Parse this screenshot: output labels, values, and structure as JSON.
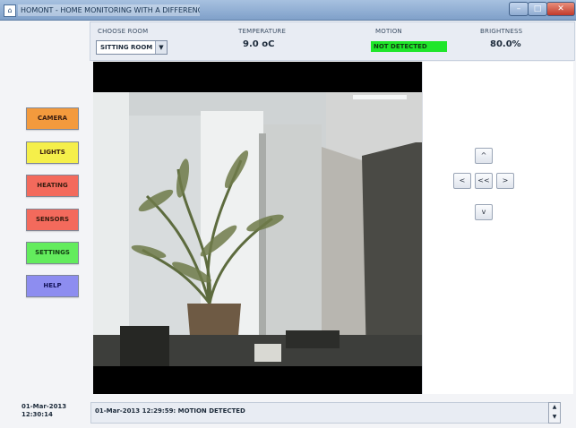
{
  "window": {
    "app_icon": "app-icon",
    "title": "HOMONT - HOME MONITORING WITH A DIFFERENCE",
    "minimize_icon": "minimize-icon",
    "maximize_icon": "maximize-icon",
    "close_icon": "close-icon"
  },
  "top_panel": {
    "choose_room_label": "CHOOSE ROOM",
    "room_selected": "SITTING ROOM",
    "temperature_label": "TEMPERATURE",
    "temperature_value": "9.0 oC",
    "motion_label": "MOTION",
    "motion_value": "NOT DETECTED",
    "motion_color": "#1fe62a",
    "brightness_label": "BRIGHTNESS",
    "brightness_value": "80.0%"
  },
  "side_buttons": [
    {
      "label": "CAMERA",
      "color": "#f39a3d"
    },
    {
      "label": "LIGHTS",
      "color": "#f5ef4a"
    },
    {
      "label": "HEATING",
      "color": "#f36a5c"
    },
    {
      "label": "SENSORS",
      "color": "#f36a5c"
    },
    {
      "label": "SETTINGS",
      "color": "#63ec5d"
    },
    {
      "label": "HELP",
      "color": "#8d8df0"
    }
  ],
  "ptz": {
    "up": "^",
    "left": "<",
    "center": "<<",
    "right": ">",
    "down": "v"
  },
  "status": {
    "date": "01-Mar-2013",
    "time": "12:30:14",
    "log": "01-Mar-2013 12:29:59: MOTION DETECTED"
  }
}
